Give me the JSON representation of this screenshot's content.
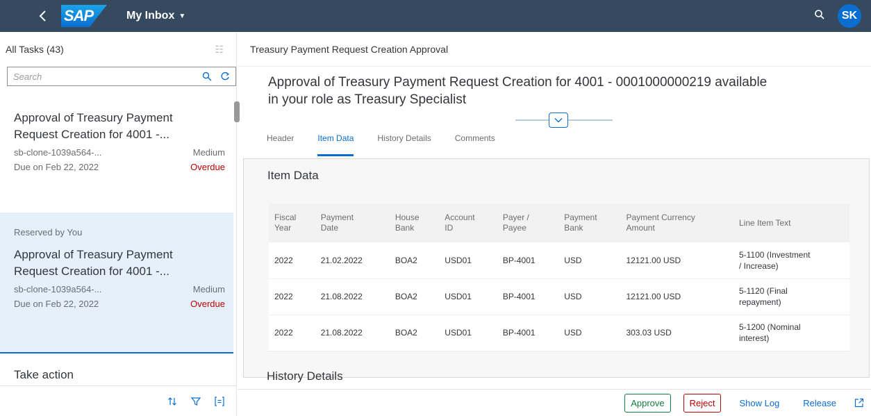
{
  "shell": {
    "logo": "SAP",
    "app_title": "My Inbox",
    "avatar_initials": "SK"
  },
  "master": {
    "header": "All Tasks (43)",
    "search_placeholder": "Search",
    "tasks": [
      {
        "reserved": "",
        "title_line1": "Approval of Treasury Payment",
        "title_line2": "Request Creation for 4001 -...",
        "id": "sb-clone-1039a564-...",
        "priority": "Medium",
        "due": "Due on Feb 22, 2022",
        "status": "Overdue"
      },
      {
        "reserved": "Reserved by You",
        "title_line1": "Approval of Treasury Payment",
        "title_line2": "Request Creation for 4001 -...",
        "id": "sb-clone-1039a564-...",
        "priority": "Medium",
        "due": "Due on Feb 22, 2022",
        "status": "Overdue"
      }
    ],
    "take_action": "Take action"
  },
  "detail": {
    "header": "Treasury Payment Request Creation Approval",
    "title_line1": "Approval of Treasury Payment Request Creation for 4001 - 0001000000219 available",
    "title_line2": "in your role as Treasury Specialist",
    "tabs": [
      "Header",
      "Item Data",
      "History Details",
      "Comments"
    ],
    "section_title": "Item Data",
    "columns": [
      [
        "Fiscal",
        "Year"
      ],
      [
        "Payment",
        "Date"
      ],
      [
        "House",
        "Bank"
      ],
      [
        "Account",
        "ID"
      ],
      [
        "Payer /",
        "Payee"
      ],
      [
        "Payment",
        "Bank"
      ],
      [
        "Payment Currency",
        "Amount"
      ],
      [
        "Line Item Text",
        ""
      ]
    ],
    "rows": [
      [
        "2022",
        "21.02.2022",
        "BOA2",
        "USD01",
        "BP-4001",
        "USD",
        "12121.00 USD",
        "5-1100 (Investment",
        "/ Increase)"
      ],
      [
        "2022",
        "21.08.2022",
        "BOA2",
        "USD01",
        "BP-4001",
        "USD",
        "12121.00 USD",
        "5-1120 (Final",
        "repayment)"
      ],
      [
        "2022",
        "21.08.2022",
        "BOA2",
        "USD01",
        "BP-4001",
        "USD",
        "303.03 USD",
        "5-1200 (Nominal",
        "interest)"
      ]
    ],
    "history_title": "History Details"
  },
  "footer": {
    "approve": "Approve",
    "reject": "Reject",
    "show_log": "Show Log",
    "release": "Release"
  }
}
